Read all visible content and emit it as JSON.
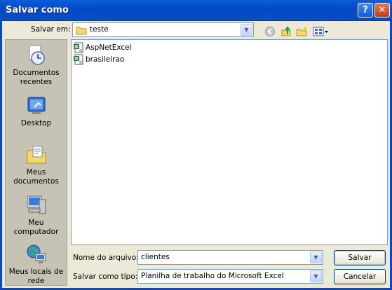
{
  "window": {
    "title": "Salvar como"
  },
  "titlebar_buttons": {
    "help_icon": "question-mark-icon",
    "close_icon": "close-x-icon"
  },
  "toolbar": {
    "save_in_label": "Salvar em:",
    "current_folder": "teste",
    "icons": [
      "back-icon",
      "up-one-level-icon",
      "new-folder-icon",
      "views-menu-icon"
    ]
  },
  "places_bar": {
    "items": [
      {
        "label": "Documentos recentes",
        "icon": "recent-documents-icon"
      },
      {
        "label": "Desktop",
        "icon": "desktop-icon"
      },
      {
        "label": "Meus documentos",
        "icon": "my-documents-icon"
      },
      {
        "label": "Meu computador",
        "icon": "my-computer-icon"
      },
      {
        "label": "Meus locais de rede",
        "icon": "network-places-icon"
      }
    ]
  },
  "files": [
    {
      "name": "AspNetExcel",
      "icon": "excel-file-icon"
    },
    {
      "name": "brasileirao",
      "icon": "excel-file-icon"
    }
  ],
  "form": {
    "filename_label": "Nome do arquivo:",
    "filename_value": "clientes",
    "filetype_label": "Salvar como tipo:",
    "filetype_value": "Planilha de trabalho do Microsoft Excel"
  },
  "buttons": {
    "save": "Salvar",
    "cancel": "Cancelar"
  },
  "colors": {
    "title_bar": "#0a5fd8",
    "dialog_bg": "#ece9d8",
    "places_bg": "#c6c3b4"
  }
}
